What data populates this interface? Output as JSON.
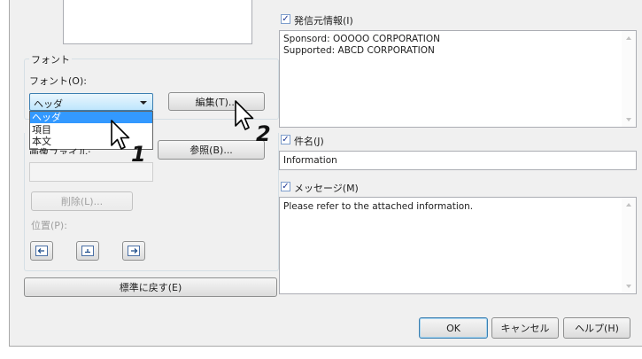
{
  "left_panel": {
    "font_group_title": "フォント",
    "font_label": "フォント(O):",
    "font_select_value": "ヘッダ",
    "font_options": [
      "ヘッダ",
      "項目",
      "本文"
    ],
    "edit_button": "編集(T)...",
    "image_file_label": "画像ファイル:",
    "browse_button": "参照(B)...",
    "delete_button": "削除(L)...",
    "position_label": "位置(P):",
    "restore_default_button": "標準に戻す(E)"
  },
  "right_panel": {
    "sender_info_label": "発信元情報(I)",
    "sender_info_text": "Sponsord: OOOOO CORPORATION\nSupported: ABCD CORPORATION",
    "subject_label": "件名(J)",
    "subject_value": "Information",
    "message_label": "メッセージ(M)",
    "message_text": "Please refer to the attached information."
  },
  "footer": {
    "ok_button": "OK",
    "cancel_button": "キャンセル",
    "help_button": "ヘルプ(H)"
  },
  "annotations": {
    "step1": "1",
    "step2": "2"
  },
  "colors": {
    "selection": "#3399ff",
    "dialog_bg": "#f0f0f0"
  }
}
